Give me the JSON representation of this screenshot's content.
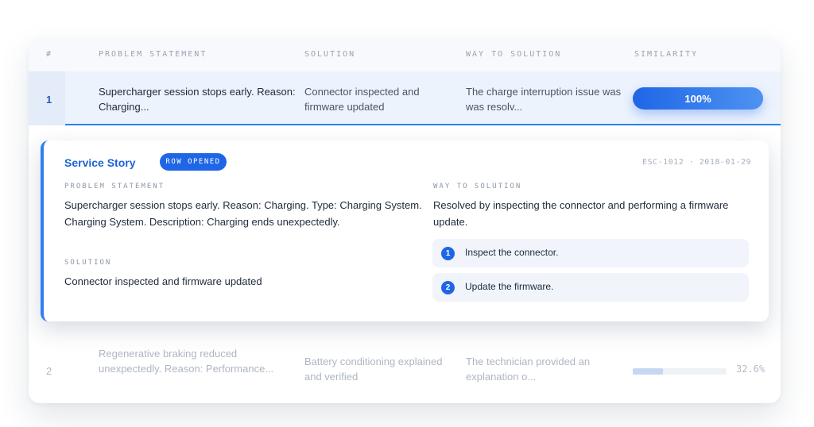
{
  "table": {
    "headers": [
      "#",
      "PROBLEM STATEMENT",
      "SOLUTION",
      "WAY TO SOLUTION",
      "SIMILARITY"
    ],
    "rows": [
      {
        "num": "1",
        "problem": "Supercharger session stops early. Reason: Charging...",
        "solution": "Connector inspected and firmware updated",
        "way": "The charge interruption issue was was resolv...",
        "similarity_label": "100%",
        "similarity": 1.0
      },
      {
        "num": "2",
        "problem": "Regenerative braking reduced unexpectedly. Reason: Performance...",
        "solution": "Battery conditioning explained and verified",
        "way": "The technician provided an explanation o...",
        "similarity_label": "32.6%",
        "similarity": 0.326
      }
    ]
  },
  "detail": {
    "title": "Service Story",
    "badge": "ROW OPENED",
    "meta": "ESC-1012 · 2018-01-29",
    "problem_label": "PROBLEM STATEMENT",
    "problem_text": "Supercharger session stops early. Reason: Charging. Type: Charging System. Charging System. Description: Charging ends unexpectedly.",
    "solution_label": "SOLUTION",
    "solution_text": "Connector inspected and firmware updated",
    "way_label": "WAY TO SOLUTION",
    "way_text": "Resolved by inspecting the connector and performing a firmware update.",
    "steps": [
      {
        "num": "1",
        "text": "Inspect the connector."
      },
      {
        "num": "2",
        "text": "Update the firmware."
      }
    ]
  },
  "colors": {
    "accent": "#1f66e6",
    "selected_row_bg": "#edf3fd",
    "muted_text": "#aeb6c2"
  }
}
